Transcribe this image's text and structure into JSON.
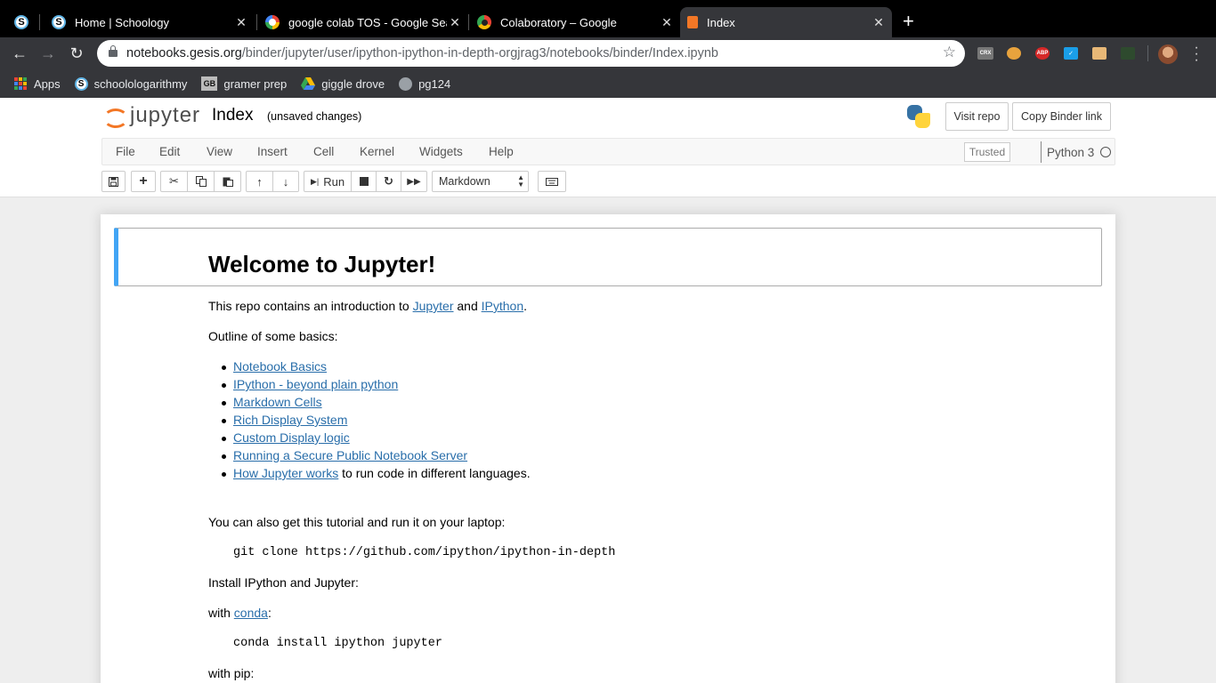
{
  "browser": {
    "tabs": [
      {
        "title": "Home | Schoology",
        "icon": "schoology-icon"
      },
      {
        "title": "google colab TOS - Google Search",
        "icon": "google-icon"
      },
      {
        "title": "Colaboratory – Google",
        "icon": "colab-icon"
      },
      {
        "title": "Index",
        "icon": "jupyter-book-icon",
        "active": true
      }
    ],
    "url_host": "notebooks.gesis.org",
    "url_path": "/binder/jupyter/user/ipython-ipython-in-depth-orgjrag3/notebooks/binder/Index.ipynb",
    "extensions": [
      {
        "name": "crx-icon",
        "label": "CRX",
        "color": "#777777"
      },
      {
        "name": "owl-extension-icon",
        "label": "",
        "color": "#e8a33d"
      },
      {
        "name": "adblock-plus-icon",
        "label": "ABP",
        "color": "#d62828"
      },
      {
        "name": "checkmark-extension-icon",
        "label": "",
        "color": "#1a9ee8"
      },
      {
        "name": "character-extension-icon",
        "label": "",
        "color": "#e8b877"
      },
      {
        "name": "scribble-extension-icon",
        "label": "",
        "color": "#2e4a2e"
      }
    ],
    "bookmarks": [
      {
        "label": "Apps",
        "icon": "apps-grid-icon"
      },
      {
        "label": "schoolologarithmy",
        "icon": "schoology-icon"
      },
      {
        "label": "gramer prep",
        "icon": "gb-icon"
      },
      {
        "label": "giggle drove",
        "icon": "google-drive-icon"
      },
      {
        "label": "pg124",
        "icon": "globe-icon"
      }
    ]
  },
  "jupyter": {
    "logo_text": "jupyter",
    "notebook_name": "Index",
    "save_status": "(unsaved changes)",
    "header_buttons": {
      "visit_repo": "Visit repo",
      "copy_binder_link": "Copy Binder link"
    },
    "menu": [
      "File",
      "Edit",
      "View",
      "Insert",
      "Cell",
      "Kernel",
      "Widgets",
      "Help"
    ],
    "trusted": "Trusted",
    "kernel": "Python 3",
    "toolbar": {
      "run_label": "Run",
      "cell_type": "Markdown"
    }
  },
  "notebook": {
    "heading": "Welcome to Jupyter!",
    "intro": {
      "pre": "This repo contains an introduction to ",
      "link1": "Jupyter",
      "mid": " and ",
      "link2": "IPython",
      "post": "."
    },
    "outline_heading": "Outline of some basics:",
    "outline": [
      "Notebook Basics",
      "IPython - beyond plain python",
      "Markdown Cells",
      "Rich Display System",
      "Custom Display logic",
      "Running a Secure Public Notebook Server",
      "How Jupyter works"
    ],
    "outline_last_suffix": " to run code in different languages.",
    "laptop_text": "You can also get this tutorial and run it on your laptop:",
    "git_clone": "git clone https://github.com/ipython/ipython-in-depth",
    "install_text": "Install IPython and Jupyter:",
    "with_conda": {
      "pre": "with ",
      "link": "conda",
      "post": ":"
    },
    "conda_cmd": "conda install ipython jupyter",
    "with_pip": "with pip:"
  }
}
